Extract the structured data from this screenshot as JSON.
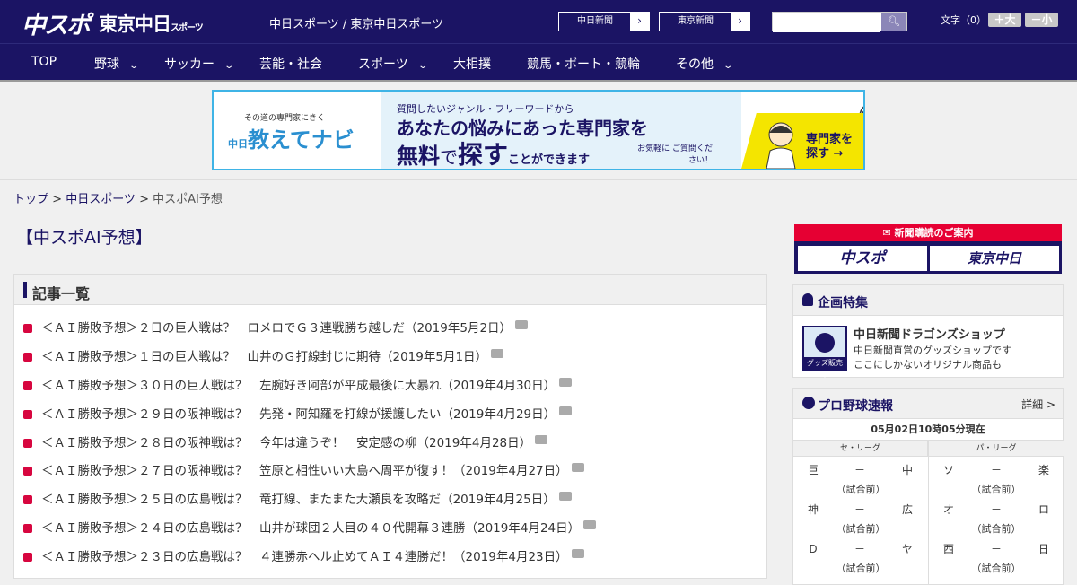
{
  "header": {
    "logo_main": "中スポ",
    "logo_tokyo": "東京中日",
    "logo_tokyo_small": "スポーツ",
    "tagline": "中日スポーツ / 東京中日スポーツ",
    "paper_buttons": [
      "中日新聞",
      "東京新聞"
    ],
    "search_placeholder": "",
    "font_size_label": "文字（0）",
    "font_plus": "＋大",
    "font_minus": "－小",
    "colors": {
      "navy": "#1b1464",
      "accent_red": "#e60033"
    }
  },
  "nav": {
    "items": [
      {
        "label": "TOP",
        "dropdown": false
      },
      {
        "label": "野球",
        "dropdown": true
      },
      {
        "label": "サッカー",
        "dropdown": true
      },
      {
        "label": "芸能・社会",
        "dropdown": false
      },
      {
        "label": "スポーツ",
        "dropdown": true
      },
      {
        "label": "大相撲",
        "dropdown": false
      },
      {
        "label": "競馬・ボート・競輪",
        "dropdown": false
      },
      {
        "label": "その他",
        "dropdown": true
      }
    ]
  },
  "banner": {
    "left_small": "その道の専門家にきく",
    "left_brand": "教えてナビ",
    "left_prefix": "中日",
    "line1": "質問したいジャンル・フリーワードから",
    "line2": "あなたの悩みにあった専門家を",
    "line3_a": "無料",
    "line3_b": "で",
    "line3_c": "探す",
    "line3_d": "ことができます",
    "note": "お気軽に ご質問ください！",
    "cta": "専門家を 探す →"
  },
  "breadcrumb": {
    "items": [
      "トップ",
      "中日スポーツ"
    ],
    "current": "中スポAI予想",
    "separator": " > "
  },
  "page": {
    "title": "【中スポAI予想】"
  },
  "article_list": {
    "heading": "記事一覧",
    "items": [
      "＜ＡＩ勝敗予想＞２日の巨人戦は？　ロメロでＧ３連戦勝ち越しだ（2019年5月2日）",
      "＜ＡＩ勝敗予想＞１日の巨人戦は？　山井のＧ打線封じに期待（2019年5月1日）",
      "＜ＡＩ勝敗予想＞３０日の巨人戦は？　左腕好き阿部が平成最後に大暴れ（2019年4月30日）",
      "＜ＡＩ勝敗予想＞２９日の阪神戦は？　先発・阿知羅を打線が援護したい（2019年4月29日）",
      "＜ＡＩ勝敗予想＞２８日の阪神戦は？　今年は違うぞ！　安定感の柳（2019年4月28日）",
      "＜ＡＩ勝敗予想＞２７日の阪神戦は？　笠原と相性いい大島へ周平が復す！（2019年4月27日）",
      "＜ＡＩ勝敗予想＞２５日の広島戦は？　竜打線、またまた大瀬良を攻略だ（2019年4月25日）",
      "＜ＡＩ勝敗予想＞２４日の広島戦は？　山井が球団２人目の４０代開幕３連勝（2019年4月24日）",
      "＜ＡＩ勝敗予想＞２３日の広島戦は？　４連勝赤ヘル止めてＡＩ４連勝だ！（2019年4月23日）"
    ]
  },
  "sidebar": {
    "subscribe_label": "新聞購読のご案内",
    "subscribe_buttons": [
      "中スポ",
      "東京中日"
    ],
    "feature": {
      "heading": "企画特集",
      "shop_badge": "グッズ販売中",
      "title": "中日新聞ドラゴンズショップ",
      "desc1": "中日新聞直営のグッズショップです",
      "desc2": "ここにしかないオリジナル商品も"
    },
    "baseball": {
      "heading": "プロ野球速報",
      "detail": "詳細 >",
      "updated": "05月02日10時05分現在",
      "leagues": [
        "セ・リーグ",
        "パ・リーグ"
      ],
      "central": [
        [
          "巨",
          "－",
          "中"
        ],
        [
          "神",
          "－",
          "広"
        ],
        [
          "Ｄ",
          "－",
          "ヤ"
        ]
      ],
      "pacific": [
        [
          "ソ",
          "－",
          "楽"
        ],
        [
          "オ",
          "－",
          "ロ"
        ],
        [
          "西",
          "－",
          "日"
        ]
      ],
      "status": "（試合前）"
    }
  }
}
